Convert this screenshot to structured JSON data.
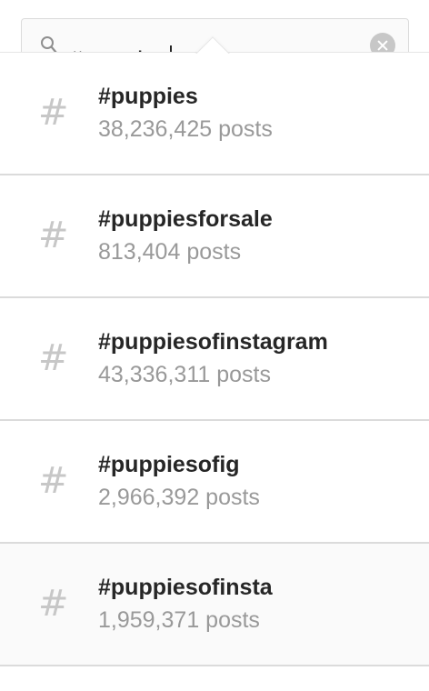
{
  "search": {
    "query": "#puppies"
  },
  "results": [
    {
      "icon": "hashtag-icon",
      "symbol": "#",
      "name": "#puppies",
      "count": "38,236,425 posts",
      "highlighted": false
    },
    {
      "icon": "hashtag-icon",
      "symbol": "#",
      "name": "#puppiesforsale",
      "count": "813,404 posts",
      "highlighted": false
    },
    {
      "icon": "hashtag-icon",
      "symbol": "#",
      "name": "#puppiesofinstagram",
      "count": "43,336,311 posts",
      "highlighted": false
    },
    {
      "icon": "hashtag-icon",
      "symbol": "#",
      "name": "#puppiesofig",
      "count": "2,966,392 posts",
      "highlighted": false
    },
    {
      "icon": "hashtag-icon",
      "symbol": "#",
      "name": "#puppiesofinsta",
      "count": "1,959,371 posts",
      "highlighted": true
    }
  ],
  "colors": {
    "text_primary": "#262626",
    "text_secondary": "#999999",
    "icon_gray": "#c7c7c7",
    "divider": "#dbdbdb",
    "highlight_bg": "#fafafa"
  }
}
